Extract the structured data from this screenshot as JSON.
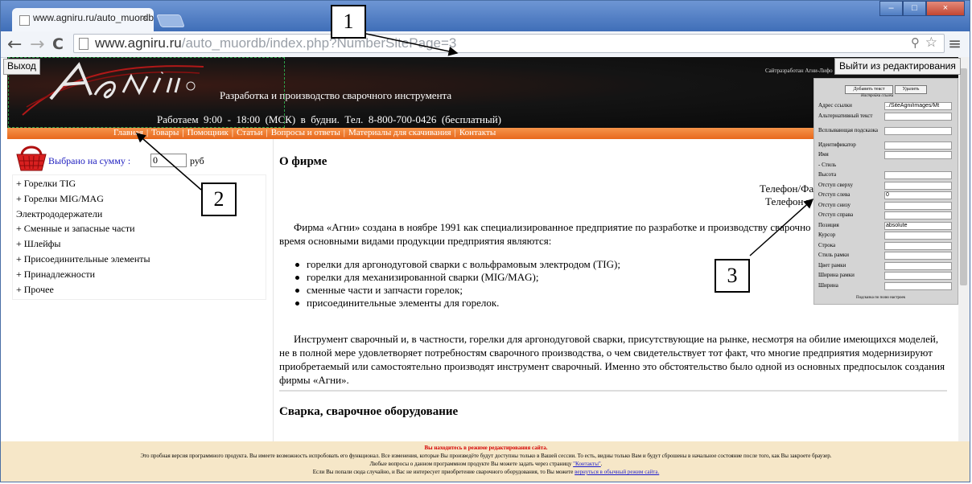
{
  "browser": {
    "tab_title": "www.agniru.ru/auto_muordb",
    "tab_close": "×",
    "url_host": "www.agniru.ru",
    "url_path": "/auto_muordb/index.php?NumberSitePage=3",
    "nav_back": "←",
    "nav_forward": "→",
    "nav_reload": "C",
    "win_min": "–",
    "win_max": "□",
    "win_close": "×",
    "zoom_icon": "zoom-icon",
    "star_icon": "star-icon",
    "menu_icon": "menu-icon"
  },
  "page": {
    "exit_label": "Выход",
    "exit_edit_label": "Выйти из редактирования",
    "tagline": "Разработка и производство сварочного инструмента",
    "hours": "Работаем  9:00  -  18:00  (МСК)  в  будни.  Тел.  8-800-700-0426  (бесплатный)",
    "dev_note": "Сайтразработан Агни-Лифо",
    "nav_items": [
      "Главная",
      "Товары",
      "Помощник",
      "Статьи",
      "Вопросы и ответы",
      "Материалы для скачивания",
      "Контакты"
    ],
    "sum_label": "Выбрано на сумму :",
    "sum_value": "0",
    "currency": "руб",
    "categories": [
      "+ Горелки TIG",
      "+ Горелки MIG/MAG",
      "Электрододержатели",
      "+ Сменные и запасные части",
      "+ Шлейфы",
      "+ Присоединительные элементы",
      "+ Принадлежности",
      "+ Прочее"
    ],
    "section1_title": "О фирме",
    "phone_fax": "Телефон/Фа",
    "phone_hotline": "Телефон г",
    "para1": "Фирма «Агни» создана в ноябре 1991 как специализированное предприятие по разработке и производству сварочно",
    "para1_line2": "время основными видами продукции предприятия являются:",
    "bullets": [
      "горелки для аргонодуговой сварки с вольфрамовым электродом (TIG);",
      "горелки для механизированной сварки (MIG/MAG);",
      "сменные части и запчасти горелок;",
      "присоединительные элементы для горелок."
    ],
    "para2": "Инструмент сварочный и, в частности, горелки для аргонодуговой сварки, присутствующие на рынке, несмотря на обилие имеющихся моделей, не в полной мере удовлетворяет потребностям сварочного производства, о чем свидетельствует тот факт, что многие предприятия модернизируют приобретаемый или самостоятельно производят инструмент сварочный. Именно это обстоятельство было одной из основных предпосылок создания фирмы «Агни».",
    "section2_title": "Сварка, сварочное оборудование"
  },
  "edit_panel": {
    "add_text": "Добавить текст",
    "delete": "Удалить",
    "title": "Настройки ссылки",
    "rows": [
      {
        "label": "Адрес ссылки",
        "value": "../SiteAgni/images/Mt"
      },
      {
        "label": "Альтернативный текст",
        "value": ""
      },
      {
        "label": "Всплывающая подсказка",
        "value": ""
      },
      {
        "label": "Идентификатор",
        "value": ""
      },
      {
        "label": "Имя",
        "value": ""
      },
      {
        "label": "- Стиль",
        "value": null
      },
      {
        "label": "Высота",
        "value": ""
      },
      {
        "label": "Отступ сверху",
        "value": ""
      },
      {
        "label": "Отступ слева",
        "value": "0"
      },
      {
        "label": "Отступ снизу",
        "value": ""
      },
      {
        "label": "Отступ справа",
        "value": ""
      },
      {
        "label": "Позиция",
        "value": "absolute"
      },
      {
        "label": "Курсор",
        "value": ""
      },
      {
        "label": "Строка",
        "value": ""
      },
      {
        "label": "Стиль рамки",
        "value": ""
      },
      {
        "label": "Цвет рамки",
        "value": ""
      },
      {
        "label": "Ширина рамки",
        "value": ""
      },
      {
        "label": "Ширина",
        "value": ""
      }
    ],
    "footer": "Подсказка по полю настроек"
  },
  "footer": {
    "warning": "Вы находитесь в режиме редактирования сайта.",
    "line1": "Это пробная версия программного продукта. Вы имеете возможность испробовать его функционал. Все изменения, которые Вы произведёте будут доступны только в Вашей сессии. То есть, видны только Вам и будут сброшены в начальное состояние после того, как Вы закроете браузер.",
    "line2_pre": "Любые вопросы о данном программном продукте Вы можете задать через страницу ",
    "line2_link": "\"Контакты\"",
    "line3_pre": "Если Вы попали сюда случайно, и Вас не интересует приобретение сварочного оборудования, то Вы можете ",
    "line3_link": "вернуться в обычный режим сайта."
  },
  "callouts": [
    "1",
    "2",
    "3"
  ],
  "colors": {
    "nav_orange": "#f07a2c",
    "footer_bg": "#f6e7c8",
    "warn_red": "#d40000",
    "banner": "#0d0d0d"
  }
}
